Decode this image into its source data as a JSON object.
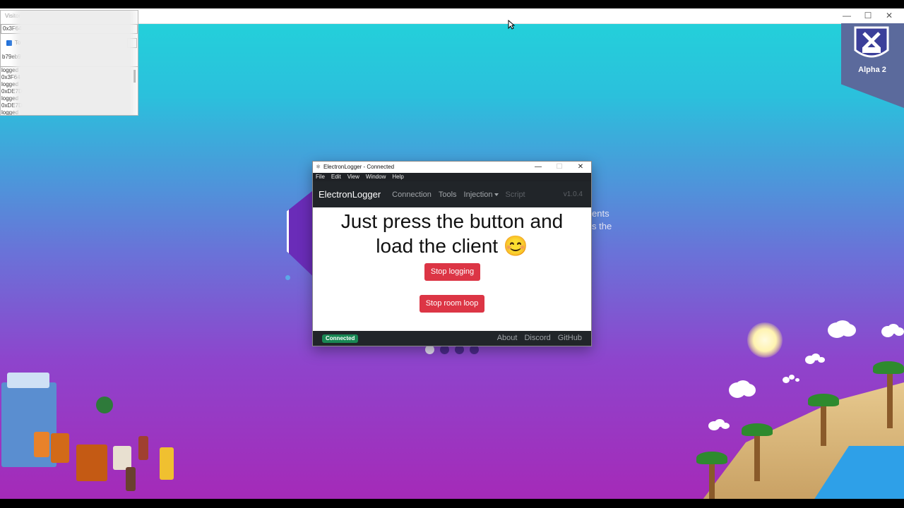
{
  "visitor_window": {
    "title": "Visitor",
    "select_value": "0x3F64",
    "checkbox_label": "To",
    "address": "b79eb9",
    "log_lines": [
      "logged",
      "0x3F64",
      "logged",
      "0xDE7D",
      "logged",
      "0xDE7D",
      "logged"
    ]
  },
  "badge": {
    "label": "Alpha 2"
  },
  "background_text": {
    "line1": "ents",
    "line2": "s the"
  },
  "app": {
    "title": "ElectronLogger - Connected",
    "menu": [
      "File",
      "Edit",
      "View",
      "Window",
      "Help"
    ],
    "brand": "ElectronLogger",
    "nav": {
      "connection": "Connection",
      "tools": "Tools",
      "injection": "Injection",
      "script": "Script"
    },
    "version": "v1.0.4",
    "heading_line1": "Just press the button and",
    "heading_line2": "load the client 😊",
    "stop_logging": "Stop logging",
    "stop_room_loop": "Stop room loop",
    "status": "Connected",
    "footer_links": {
      "about": "About",
      "discord": "Discord",
      "github": "GitHub"
    }
  },
  "colors": {
    "accent_red": "#dc3545",
    "navbar": "#212529",
    "connected_green": "#198754"
  }
}
